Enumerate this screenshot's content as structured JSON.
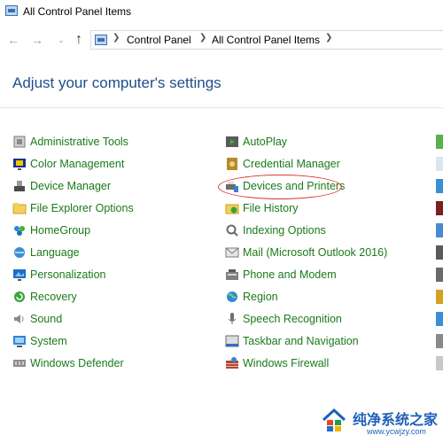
{
  "window": {
    "title": "All Control Panel Items"
  },
  "nav": {
    "back_icon": "arrow-left-icon",
    "forward_icon": "arrow-right-icon",
    "recent_icon": "chevron-down-icon",
    "up_icon": "arrow-up-icon",
    "address": {
      "crumbs": [
        "Control Panel",
        "All Control Panel Items"
      ]
    }
  },
  "content": {
    "heading": "Adjust your computer's settings",
    "column1": [
      {
        "label": "Administrative Tools",
        "icon": "admin-tools-icon"
      },
      {
        "label": "Color Management",
        "icon": "color-management-icon"
      },
      {
        "label": "Device Manager",
        "icon": "device-manager-icon"
      },
      {
        "label": "File Explorer Options",
        "icon": "folder-options-icon"
      },
      {
        "label": "HomeGroup",
        "icon": "homegroup-icon"
      },
      {
        "label": "Language",
        "icon": "language-icon"
      },
      {
        "label": "Personalization",
        "icon": "personalization-icon"
      },
      {
        "label": "Recovery",
        "icon": "recovery-icon"
      },
      {
        "label": "Sound",
        "icon": "sound-icon"
      },
      {
        "label": "System",
        "icon": "system-icon"
      },
      {
        "label": "Windows Defender",
        "icon": "windows-defender-icon"
      }
    ],
    "column2": [
      {
        "label": "AutoPlay",
        "icon": "autoplay-icon"
      },
      {
        "label": "Credential Manager",
        "icon": "credential-manager-icon"
      },
      {
        "label": "Devices and Printers",
        "icon": "devices-printers-icon"
      },
      {
        "label": "File History",
        "icon": "file-history-icon"
      },
      {
        "label": "Indexing Options",
        "icon": "indexing-options-icon"
      },
      {
        "label": "Mail (Microsoft Outlook 2016)",
        "icon": "mail-icon"
      },
      {
        "label": "Phone and Modem",
        "icon": "phone-modem-icon"
      },
      {
        "label": "Region",
        "icon": "region-icon"
      },
      {
        "label": "Speech Recognition",
        "icon": "microphone-icon"
      },
      {
        "label": "Taskbar and Navigation",
        "icon": "taskbar-icon"
      },
      {
        "label": "Windows Firewall",
        "icon": "firewall-icon"
      }
    ]
  },
  "annotation": {
    "highlighted_item": "Devices and Printers",
    "color": "#e03030"
  },
  "watermark": {
    "text": "纯净系统之家",
    "url": "www.ycwjzy.com"
  },
  "colors": {
    "link_green": "#1a7a1a",
    "heading_blue": "#1e4e8c"
  }
}
